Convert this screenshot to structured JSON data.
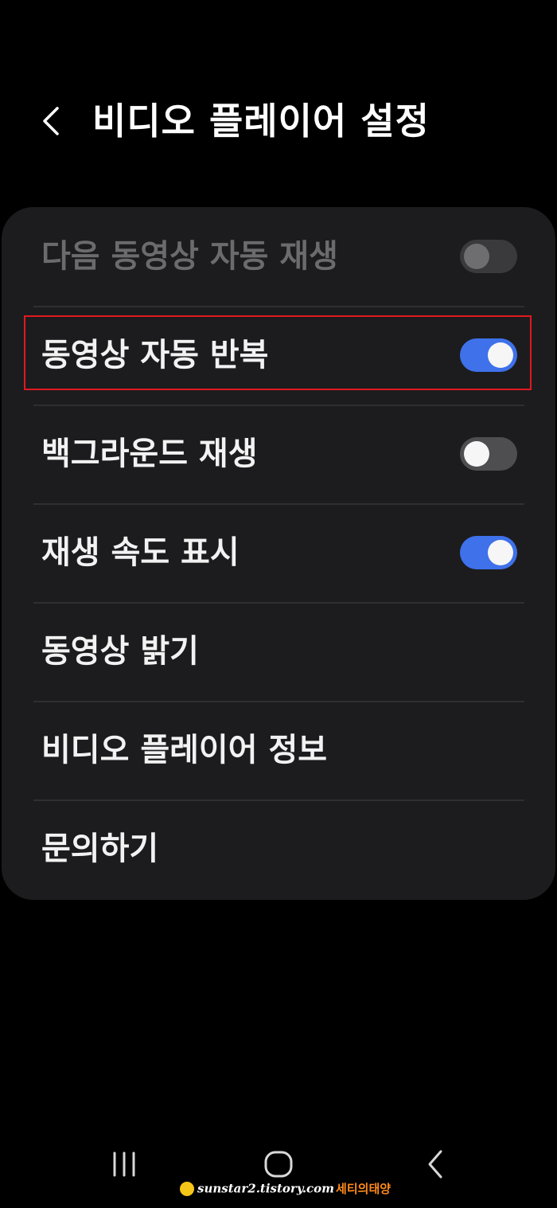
{
  "header": {
    "title": "비디오 플레이어 설정",
    "back_icon": "chevron-left-icon"
  },
  "settings": {
    "items": [
      {
        "label": "다음 동영상 자동 재생",
        "toggle": false,
        "enabled": false
      },
      {
        "label": "동영상 자동 반복",
        "toggle": true,
        "enabled": true,
        "highlighted": true
      },
      {
        "label": "백그라운드 재생",
        "toggle": false,
        "enabled": true
      },
      {
        "label": "재생 속도 표시",
        "toggle": true,
        "enabled": true
      },
      {
        "label": "동영상 밝기"
      },
      {
        "label": "비디오 플레이어 정보"
      },
      {
        "label": "문의하기"
      }
    ]
  },
  "navbar": {
    "recents_icon": "recent-apps-icon",
    "home_icon": "home-icon",
    "back_icon": "back-icon"
  },
  "watermark": {
    "url": "sunstar2.tistory.com",
    "name": "세티의태양"
  },
  "colors": {
    "background": "#000000",
    "card": "#1c1c1e",
    "toggle_on": "#3e71ea",
    "toggle_off": "#4e4e50",
    "highlight_border": "#e0191f",
    "disabled_text": "#6b6b6d"
  }
}
